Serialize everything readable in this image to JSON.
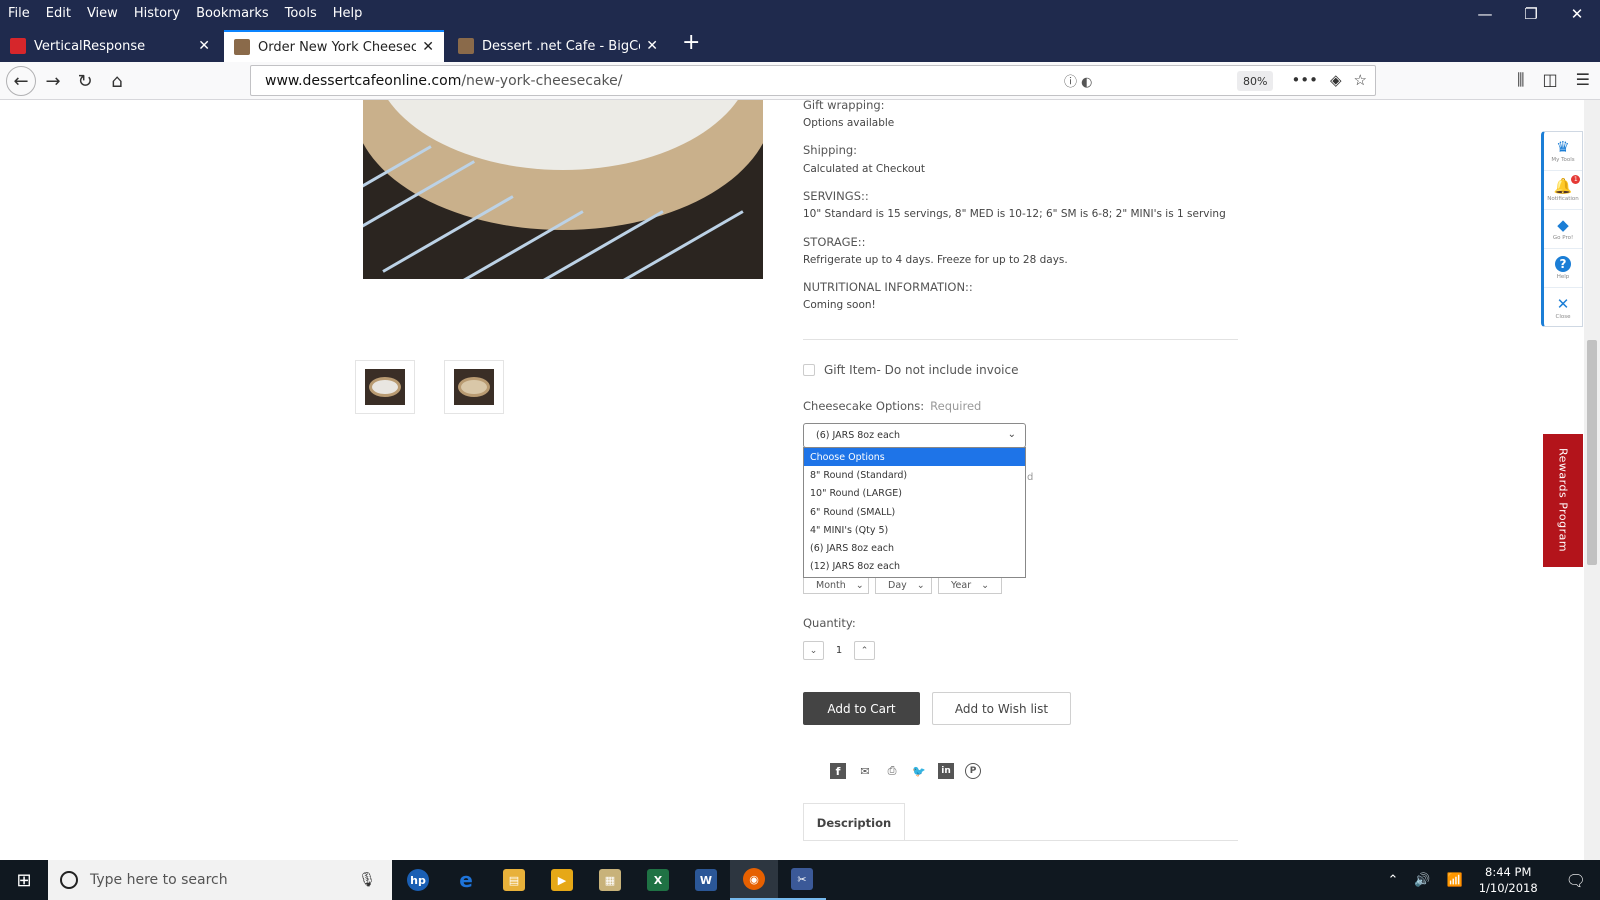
{
  "menu": [
    "File",
    "Edit",
    "View",
    "History",
    "Bookmarks",
    "Tools",
    "Help"
  ],
  "menu_access_keys": [
    "F",
    "E",
    "V",
    "H",
    "B",
    "T",
    "H"
  ],
  "window_controls": {
    "minimize": "—",
    "restore": "❐",
    "close": "✕"
  },
  "tabs": [
    {
      "title": "VerticalResponse",
      "favicon_color": "#d6262b"
    },
    {
      "title": "Order New York Cheesecake on",
      "favicon_color": "#8a6a4a"
    },
    {
      "title": "Dessert .net Cafe - BigCommer",
      "favicon_color": "#8a6a4a"
    }
  ],
  "address": {
    "domain": "www.dessertcafeonline.com",
    "path": "/new-york-cheesecake/",
    "zoom": "80%"
  },
  "product": {
    "details": [
      {
        "label": "Gift wrapping:",
        "value": "Options available"
      },
      {
        "label": "Shipping:",
        "value": "Calculated at Checkout"
      },
      {
        "label": "SERVINGS::",
        "value": "10\" Standard is 15 servings, 8\" MED is 10-12; 6\" SM is 6-8; 2\" MINI's is 1 serving"
      },
      {
        "label": "STORAGE::",
        "value": "Refrigerate up to 4 days. Freeze for up to 28 days."
      },
      {
        "label": "NUTRITIONAL INFORMATION::",
        "value": "Coming soon!"
      }
    ],
    "gift_item_label": "Gift Item- Do not include invoice",
    "options_label": "Cheesecake Options:",
    "required_label": "Required",
    "selected_option": "(6) JARS 8oz each",
    "dropdown_options": [
      "Choose Options",
      "8\" Round (Standard)",
      "10\" Round (LARGE)",
      "6\" Round (SMALL)",
      "4\" MINI's (Qty 5)",
      "(6) JARS 8oz each",
      "(12) JARS 8oz each"
    ],
    "hidden_text": "d",
    "date_selects": [
      "Month",
      "Day",
      "Year"
    ],
    "quantity_label": "Quantity:",
    "quantity": "1",
    "add_to_cart": "Add to Cart",
    "add_to_wishlist": "Add to Wish list",
    "share_icons": [
      "f",
      "✉",
      "⎙",
      "🐦",
      "in",
      "P"
    ],
    "description_tab": "Description"
  },
  "sidetools": [
    {
      "icon": "♛",
      "label": "My Tools"
    },
    {
      "icon": "🔔",
      "label": "Notification",
      "badge": "1"
    },
    {
      "icon": "◆",
      "label": "Go Pro!"
    },
    {
      "icon": "?",
      "label": "Help"
    },
    {
      "icon": "✕",
      "label": "Close"
    }
  ],
  "rewards_label": "Rewards Program",
  "taskbar": {
    "search_placeholder": "Type here to search",
    "apps": [
      {
        "name": "hp",
        "color": "#1a5fb4",
        "glyph": "hp"
      },
      {
        "name": "edge",
        "color": "#1e73d8",
        "glyph": "e"
      },
      {
        "name": "file-explorer",
        "color": "#e8b13a",
        "glyph": "▤"
      },
      {
        "name": "media-player",
        "color": "#e6a817",
        "glyph": "▶"
      },
      {
        "name": "folder",
        "color": "#c8b27a",
        "glyph": "▦"
      },
      {
        "name": "excel",
        "color": "#1f7244",
        "glyph": "X"
      },
      {
        "name": "word",
        "color": "#2b5797",
        "glyph": "W"
      },
      {
        "name": "firefox",
        "color": "#e66000",
        "glyph": "◉"
      },
      {
        "name": "snipping-tool",
        "color": "#3b5998",
        "glyph": "✂"
      }
    ],
    "time": "8:44 PM",
    "date": "1/10/2018"
  }
}
